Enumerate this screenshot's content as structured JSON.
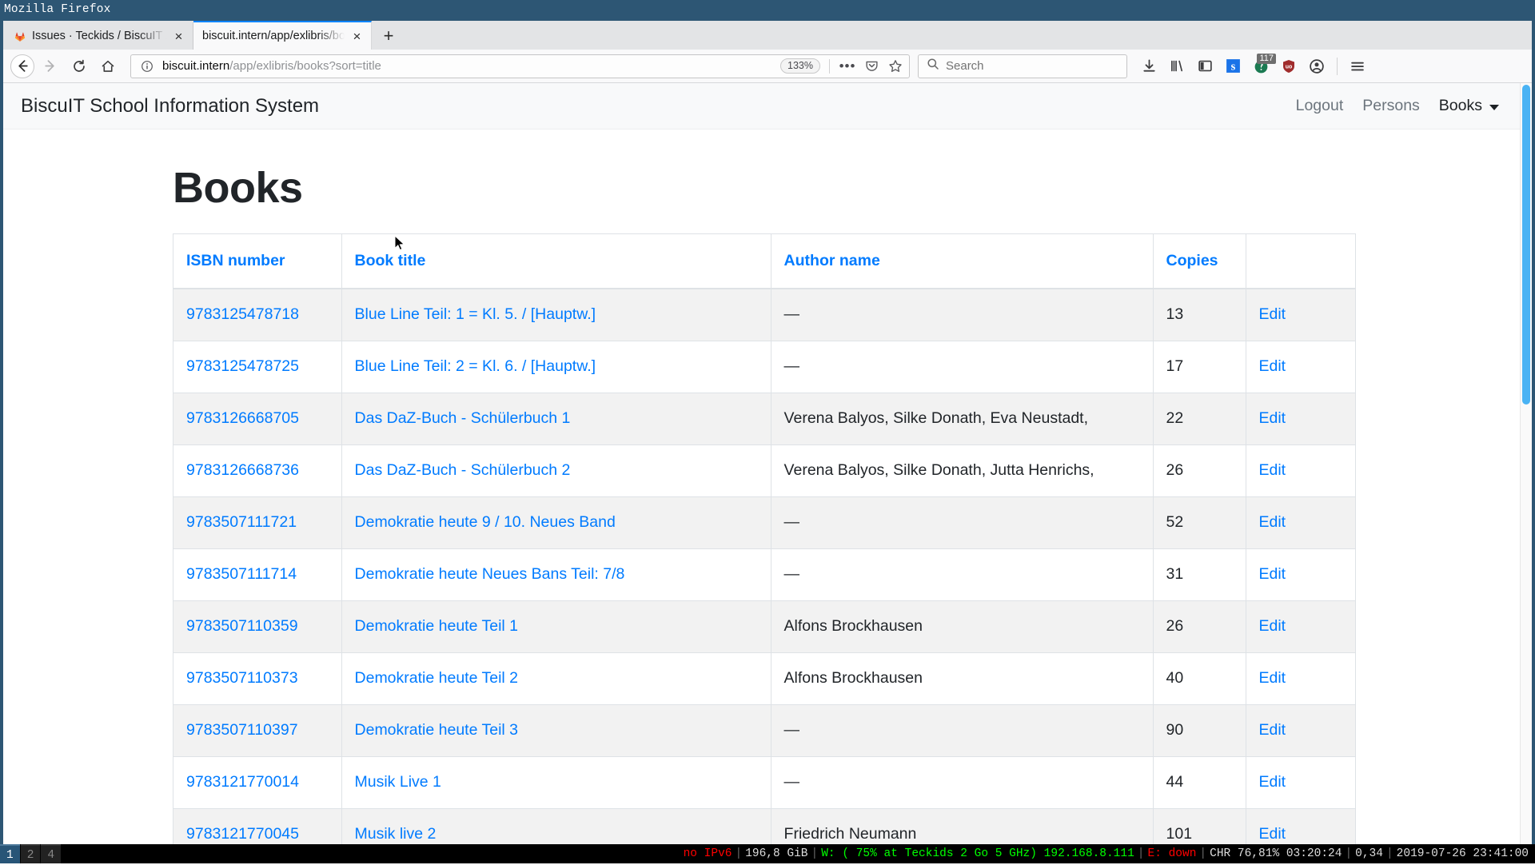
{
  "window": {
    "wm_title": "Mozilla Firefox"
  },
  "browser": {
    "tabs": [
      {
        "title": "Issues · Teckids / BiscuIT / E",
        "favicon": "gitlab-fox-icon",
        "active": false,
        "close_label": "×"
      },
      {
        "title": "biscuit.intern/app/exlibris/boo",
        "favicon": "none",
        "active": true,
        "close_label": "×"
      }
    ],
    "new_tab_label": "+",
    "nav": {
      "back": "back-arrow-icon",
      "forward": "forward-arrow-icon",
      "reload": "reload-icon",
      "home": "home-icon"
    },
    "urlbar": {
      "info_icon": "page-info-icon",
      "host": "biscuit.intern",
      "path": "/app/exlibris/books?sort=title",
      "zoom_level": "133%",
      "page_actions_label": "•••",
      "pocket_icon": "pocket-icon",
      "bookmark_icon": "star-icon"
    },
    "searchbar": {
      "icon": "search-icon",
      "placeholder": "Search",
      "value": ""
    },
    "toolbar_icons": [
      {
        "name": "downloads-icon",
        "badge": ""
      },
      {
        "name": "library-icon",
        "badge": ""
      },
      {
        "name": "sidebar-icon",
        "badge": ""
      },
      {
        "name": "extension-s-icon",
        "badge": ""
      },
      {
        "name": "extension-shield-icon",
        "badge": "117"
      },
      {
        "name": "ublock-origin-icon",
        "badge": ""
      },
      {
        "name": "account-icon",
        "badge": ""
      },
      {
        "name": "hamburger-menu-icon",
        "badge": ""
      }
    ]
  },
  "site": {
    "brand": "BiscuIT School Information System",
    "nav_links": [
      {
        "label": "Logout",
        "active": false
      },
      {
        "label": "Persons",
        "active": false
      },
      {
        "label": "Books",
        "active": true
      }
    ],
    "page_title": "Books",
    "table": {
      "headers": [
        "ISBN number",
        "Book title",
        "Author name",
        "Copies",
        ""
      ],
      "edit_label": "Edit",
      "empty_author": "—",
      "rows": [
        {
          "isbn": "9783125478718",
          "title": "Blue Line Teil: 1 = Kl. 5. / [Hauptw.]",
          "author": "—",
          "copies": "13",
          "edit": "Edit"
        },
        {
          "isbn": "9783125478725",
          "title": "Blue Line Teil: 2 = Kl. 6. / [Hauptw.]",
          "author": "—",
          "copies": "17",
          "edit": "Edit"
        },
        {
          "isbn": "9783126668705",
          "title": "Das DaZ-Buch - Schülerbuch 1",
          "author": "Verena Balyos, Silke Donath, Eva Neustadt,",
          "copies": "22",
          "edit": "Edit"
        },
        {
          "isbn": "9783126668736",
          "title": "Das DaZ-Buch - Schülerbuch 2",
          "author": "Verena Balyos, Silke Donath, Jutta Henrichs,",
          "copies": "26",
          "edit": "Edit"
        },
        {
          "isbn": "9783507111721",
          "title": "Demokratie heute 9 / 10. Neues Band",
          "author": "—",
          "copies": "52",
          "edit": "Edit"
        },
        {
          "isbn": "9783507111714",
          "title": "Demokratie heute Neues Bans Teil: 7/8",
          "author": "—",
          "copies": "31",
          "edit": "Edit"
        },
        {
          "isbn": "9783507110359",
          "title": "Demokratie heute Teil 1",
          "author": "Alfons Brockhausen",
          "copies": "26",
          "edit": "Edit"
        },
        {
          "isbn": "9783507110373",
          "title": "Demokratie heute Teil 2",
          "author": "Alfons Brockhausen",
          "copies": "40",
          "edit": "Edit"
        },
        {
          "isbn": "9783507110397",
          "title": "Demokratie heute Teil 3",
          "author": "—",
          "copies": "90",
          "edit": "Edit"
        },
        {
          "isbn": "9783121770014",
          "title": "Musik Live 1",
          "author": "—",
          "copies": "44",
          "edit": "Edit"
        },
        {
          "isbn": "9783121770045",
          "title": "Musik live 2",
          "author": "Friedrich Neumann",
          "copies": "101",
          "edit": "Edit"
        }
      ]
    }
  },
  "statusbar": {
    "workspaces": [
      {
        "label": "1",
        "focused": true
      },
      {
        "label": "2",
        "focused": false
      },
      {
        "label": "4",
        "focused": false
      }
    ],
    "segments": {
      "ipv6": "no IPv6",
      "disk": "196,8 GiB",
      "wifi": "W: ( 75% at Teckids 2 Go 5 GHz) 192.168.8.111",
      "ethernet": "E: down",
      "battery": "CHR 76,81% 03:20:24",
      "load": "0,34",
      "datetime": "2019-07-26 23:41:00"
    }
  },
  "colors": {
    "link": "#007bff",
    "wm_titlebar": "#2d5674",
    "tab_active_accent": "#0a84ff",
    "scrollbar_thumb": "#4ab3f4",
    "workspace_focused": "#285577"
  }
}
